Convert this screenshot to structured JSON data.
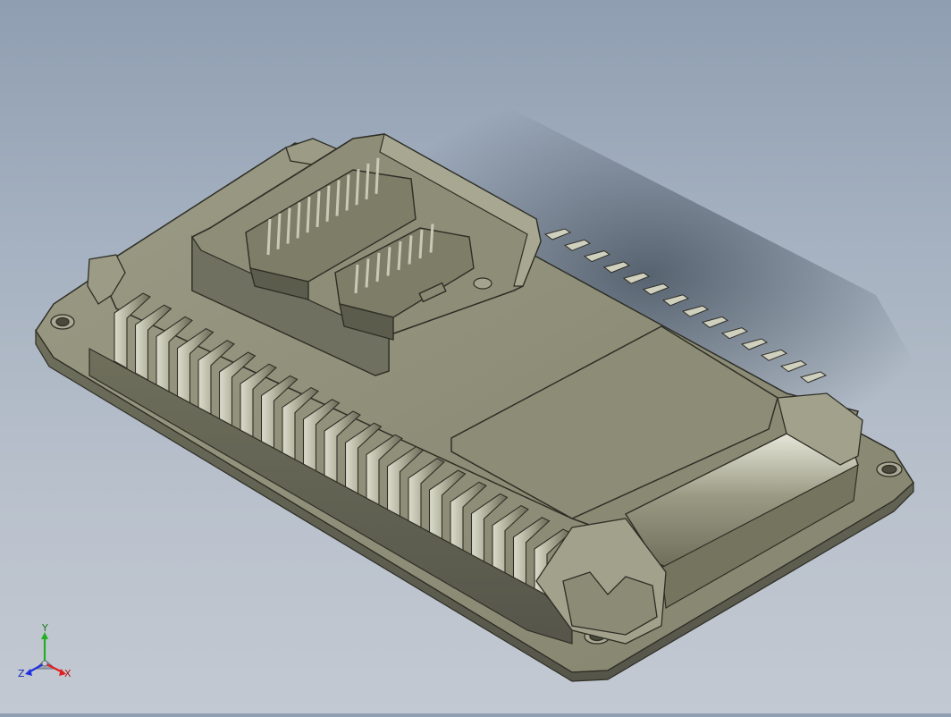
{
  "viewport": {
    "background_top": "#8f9eb1",
    "background_bottom": "#c3c9d2",
    "model_color": "#8a8a73",
    "model_highlight": "#d4d4c4",
    "model_shadow": "#4e4e40"
  },
  "triad": {
    "x_label": "X",
    "y_label": "Y",
    "z_label": "Z",
    "x_color": "#e02020",
    "y_color": "#20b020",
    "z_color": "#2030e0"
  }
}
